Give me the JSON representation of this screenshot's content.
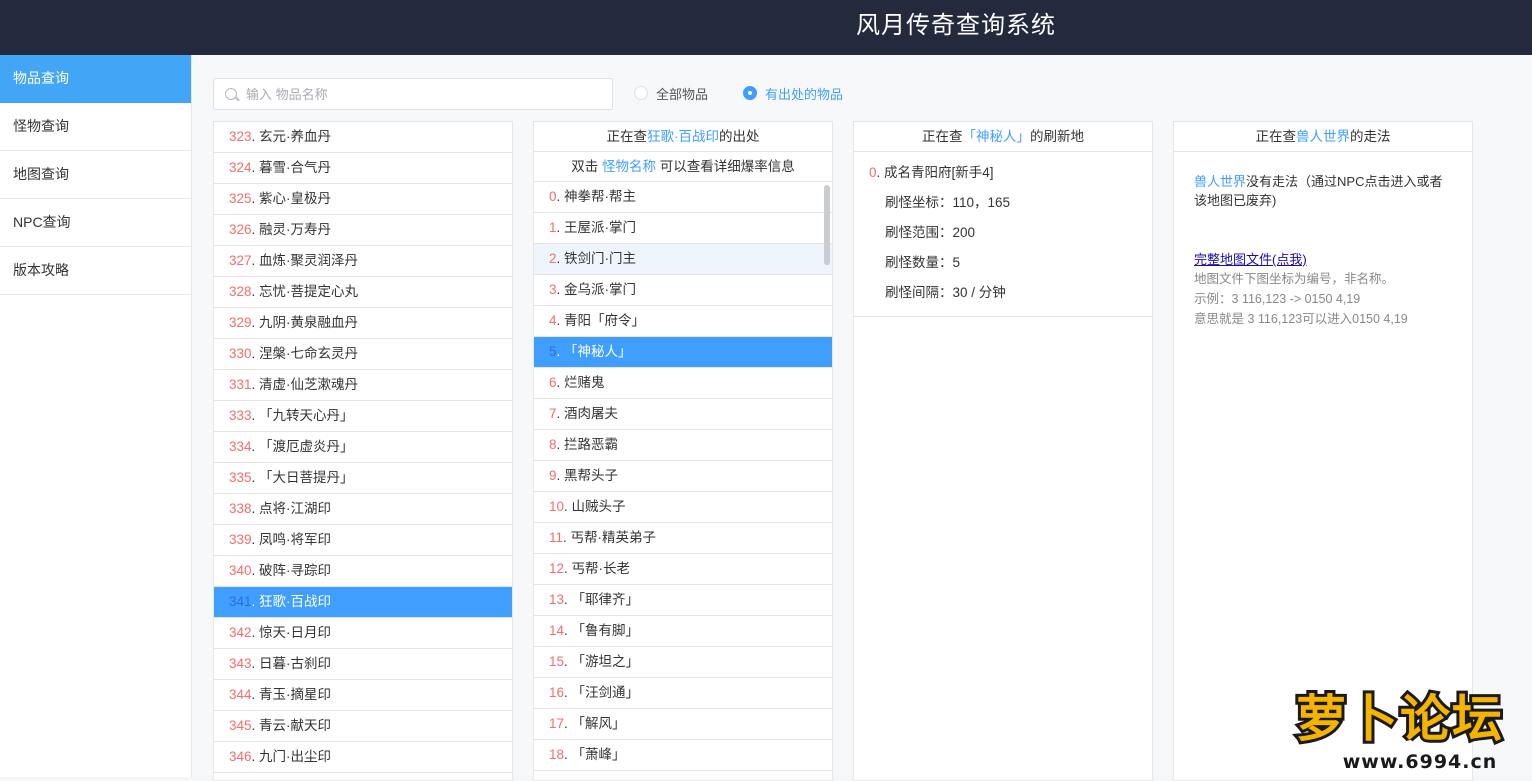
{
  "header": {
    "title": "风月传奇查询系统"
  },
  "sidebar": {
    "items": [
      {
        "label": "物品查询",
        "active": true
      },
      {
        "label": "怪物查询",
        "active": false
      },
      {
        "label": "地图查询",
        "active": false
      },
      {
        "label": "NPC查询",
        "active": false
      },
      {
        "label": "版本攻略",
        "active": false
      }
    ]
  },
  "search": {
    "placeholder": "输入 物品名称",
    "value": ""
  },
  "filters": [
    {
      "label": "全部物品",
      "checked": false
    },
    {
      "label": "有出处的物品",
      "checked": true
    }
  ],
  "items_list": [
    {
      "num": "323",
      "name": "玄元·养血丹"
    },
    {
      "num": "324",
      "name": "暮雪·合气丹"
    },
    {
      "num": "325",
      "name": "紫心·皇极丹"
    },
    {
      "num": "326",
      "name": "融灵·万寿丹"
    },
    {
      "num": "327",
      "name": "血炼·聚灵润泽丹"
    },
    {
      "num": "328",
      "name": "忘忧·菩提定心丸"
    },
    {
      "num": "329",
      "name": "九阴·黄泉融血丹"
    },
    {
      "num": "330",
      "name": "涅槃·七命玄灵丹"
    },
    {
      "num": "331",
      "name": "清虚·仙芝漱魂丹"
    },
    {
      "num": "333",
      "name": "「九转天心丹」"
    },
    {
      "num": "334",
      "name": "「渡厄虚炎丹」"
    },
    {
      "num": "335",
      "name": "「大日菩提丹」"
    },
    {
      "num": "338",
      "name": "点将·江湖印"
    },
    {
      "num": "339",
      "name": "凤鸣·将军印"
    },
    {
      "num": "340",
      "name": "破阵·寻踪印"
    },
    {
      "num": "341",
      "name": "狂歌·百战印",
      "selected": true
    },
    {
      "num": "342",
      "name": "惊天·日月印"
    },
    {
      "num": "343",
      "name": "日暮·古刹印"
    },
    {
      "num": "344",
      "name": "青玉·摘星印"
    },
    {
      "num": "345",
      "name": "青云·献天印"
    },
    {
      "num": "346",
      "name": "九门·出尘印"
    }
  ],
  "source_panel": {
    "head_prefix": "正在查",
    "head_item": "狂歌·百战印",
    "head_suffix": "的出处",
    "sub_prefix": "双击 ",
    "sub_link": "怪物名称",
    "sub_suffix": " 可以查看详细爆率信息",
    "monsters": [
      {
        "num": "0",
        "name": "神拳帮·帮主"
      },
      {
        "num": "1",
        "name": "王屋派·掌门"
      },
      {
        "num": "2",
        "name": "铁剑门·门主",
        "hover": true
      },
      {
        "num": "3",
        "name": "金乌派·掌门"
      },
      {
        "num": "4",
        "name": "青阳「府令」"
      },
      {
        "num": "5",
        "name": "「神秘人」",
        "selected": true
      },
      {
        "num": "6",
        "name": "烂赌鬼"
      },
      {
        "num": "7",
        "name": "酒肉屠夫"
      },
      {
        "num": "8",
        "name": "拦路恶霸"
      },
      {
        "num": "9",
        "name": "黑帮头子"
      },
      {
        "num": "10",
        "name": "山贼头子"
      },
      {
        "num": "11",
        "name": "丐帮·精英弟子"
      },
      {
        "num": "12",
        "name": "丐帮·长老"
      },
      {
        "num": "13",
        "name": "「耶律齐」"
      },
      {
        "num": "14",
        "name": "「鲁有脚」"
      },
      {
        "num": "15",
        "name": "「游坦之」"
      },
      {
        "num": "16",
        "name": "「汪剑通」"
      },
      {
        "num": "17",
        "name": "「解风」"
      },
      {
        "num": "18",
        "name": "「萧峰」"
      }
    ]
  },
  "spawn_panel": {
    "head_prefix": "正在查",
    "head_monster": "「神秘人」",
    "head_suffix": "的刷新地",
    "entry_num": "0",
    "entry_map": "成名青阳府[新手4]",
    "coord": "刷怪坐标：110，165",
    "range": "刷怪范围：200",
    "count": "刷怪数量：5",
    "interval": "刷怪间隔：30 / 分钟"
  },
  "route_panel": {
    "head_prefix": "正在查",
    "head_map": "兽人世界",
    "head_suffix": "的走法",
    "msg_map": "兽人世界",
    "msg_text": "没有走法（通过NPC点击进入或者该地图已废弃)",
    "link": "完整地图文件(点我)",
    "note1": "地图文件下图坐标为编号，非名称。",
    "note2": "示例：3 116,123 -> 0150 4,19",
    "note3": "意思就是 3 116,123可以进入0150 4,19"
  },
  "watermark": {
    "text": "萝卜论坛",
    "url": "www.6994.cn"
  }
}
